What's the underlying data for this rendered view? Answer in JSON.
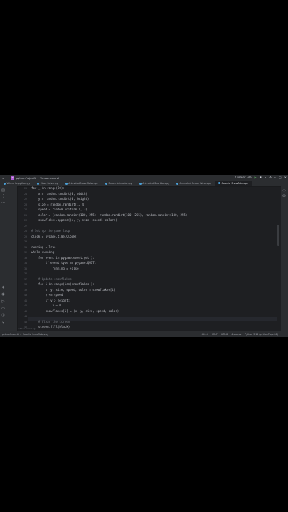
{
  "titlebar": {
    "project": "pythonProject1",
    "vcs": "Version control",
    "run_config": "Current File",
    "badge": "P"
  },
  "tabs": [
    {
      "label": "Where to python.py",
      "active": false
    },
    {
      "label": "Maze Solver.py",
      "active": false
    },
    {
      "label": "Animated Maze Solver.py",
      "active": false
    },
    {
      "label": "Spoon Animation.py",
      "active": false
    },
    {
      "label": "Animated Star Wars.py",
      "active": false
    },
    {
      "label": "Animated Ocean Waves.py",
      "active": false
    },
    {
      "label": "Colorful Snowflakes.py",
      "active": true
    }
  ],
  "gutter_lines": [
    "20",
    "21",
    "22",
    "23",
    "24",
    "25",
    "26",
    "27",
    "28",
    "29",
    "30",
    "31",
    "32",
    "33",
    "34",
    "35",
    "36",
    "37",
    "38",
    "39",
    "40",
    "41",
    "42",
    "43",
    "44",
    "45",
    "46",
    "47",
    "48",
    "49",
    "50"
  ],
  "code": [
    "for _ in range(50):",
    "    x = random.randint(0, width)",
    "    y = random.randint(0, height)",
    "    size = random.randint(1, 4)",
    "    speed = random.uniform(1, 3)",
    "    color = (random.randint(100, 255), random.randint(100, 255), random.randint(100, 255))",
    "    snowflakes.append((x, y, size, speed, color))",
    "",
    "# Set up the game loop",
    "clock = pygame.time.Clock()",
    "",
    "running = True",
    "while running:",
    "    for event in pygame.event.get():",
    "        if event.type == pygame.QUIT:",
    "            running = False",
    "",
    "    # Update snowflakes",
    "    for i in range(len(snowflakes)):",
    "        x, y, size, speed, color = snowflakes[i]",
    "        y += speed",
    "        if y > height:",
    "            y = 0",
    "        snowflakes[i] = (x, y, size, speed, color)",
    "",
    "    # Clear the screen",
    "    screen.fill(black)"
  ],
  "run_hint": "while running",
  "statusbar": {
    "path": "pythonProject1 > Colorful Snowflakes.py",
    "position": "44:14",
    "line_sep": "CRLF",
    "encoding": "UTF-8",
    "indent": "4 spaces",
    "interpreter": "Python 3.12 (pythonProject1)"
  }
}
